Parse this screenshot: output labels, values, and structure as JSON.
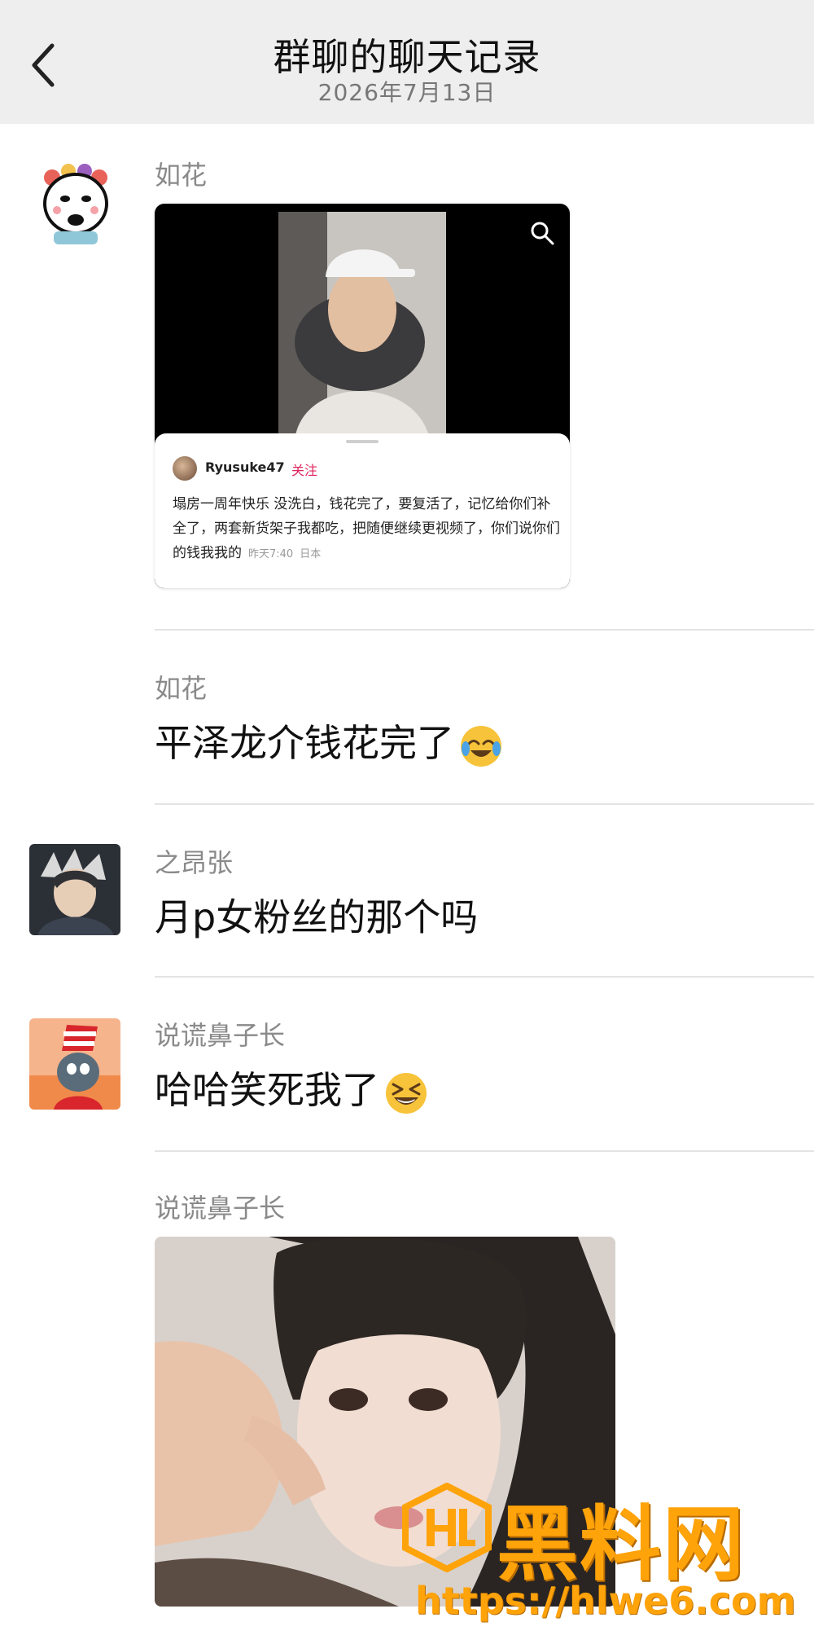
{
  "header": {
    "title": "群聊的聊天记录",
    "date": "2026年7月13日"
  },
  "messages": [
    {
      "sender": "如花",
      "type": "shared_post",
      "post": {
        "username": "Ryusuke47",
        "follow_label": "关注",
        "body": "塌房一周年快乐 没洗白，钱花完了，要复活了，记忆给你们补全了，两套新货架子我都吃，把随便继续更视频了，你们说你们的钱我我的",
        "time": "昨天7:40",
        "location": "日本"
      }
    },
    {
      "sender": "如花",
      "type": "text",
      "text": "平泽龙介钱花完了",
      "emoji": "tears-of-joy-emoji"
    },
    {
      "sender": "之昂张",
      "type": "text",
      "text": "月p女粉丝的那个吗"
    },
    {
      "sender": "说谎鼻子长",
      "type": "text",
      "text": "哈哈笑死我了",
      "emoji": "grinning-squinting-emoji"
    },
    {
      "sender": "说谎鼻子长",
      "type": "image"
    }
  ],
  "watermark": {
    "brand": "黑料网",
    "url": "https://hlwe6.com"
  },
  "colors": {
    "header_bg": "#eeeeee",
    "follow": "#e0245e",
    "watermark": "#ffa30a"
  }
}
